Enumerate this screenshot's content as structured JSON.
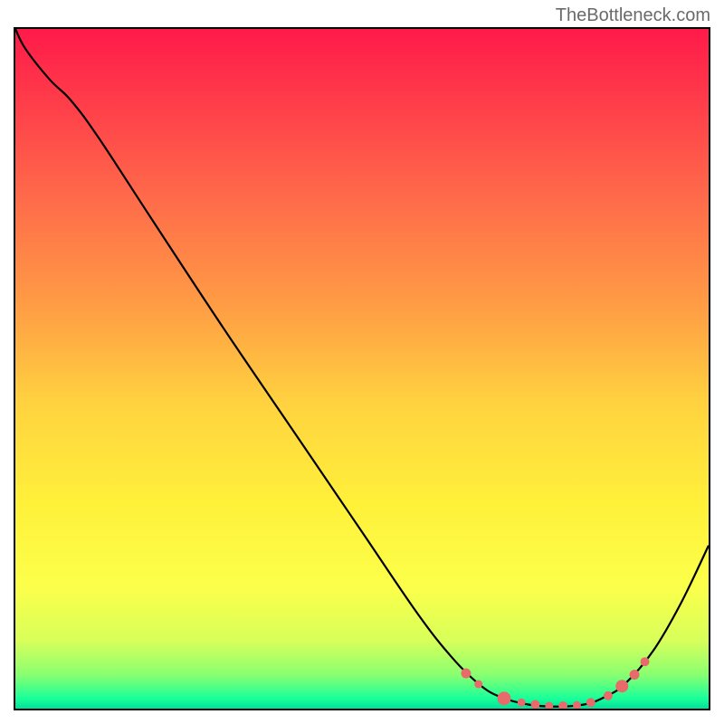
{
  "watermark": "TheBottleneck.com",
  "chart_data": {
    "type": "line",
    "title": "",
    "xlabel": "",
    "ylabel": "",
    "xlim": [
      0,
      100
    ],
    "ylim": [
      0,
      100
    ],
    "background_gradient": {
      "stops": [
        {
          "pos": 0.0,
          "color": "#ff1a4a"
        },
        {
          "pos": 0.1,
          "color": "#ff3a4a"
        },
        {
          "pos": 0.25,
          "color": "#ff6b4a"
        },
        {
          "pos": 0.4,
          "color": "#ff9a45"
        },
        {
          "pos": 0.55,
          "color": "#ffd23f"
        },
        {
          "pos": 0.7,
          "color": "#fff13a"
        },
        {
          "pos": 0.82,
          "color": "#fcff4a"
        },
        {
          "pos": 0.9,
          "color": "#d8ff5a"
        },
        {
          "pos": 0.95,
          "color": "#8aff70"
        },
        {
          "pos": 0.985,
          "color": "#1aff9a"
        },
        {
          "pos": 1.0,
          "color": "#00e09a"
        }
      ]
    },
    "series": [
      {
        "name": "main-curve",
        "stroke": "#000000",
        "stroke_width": 2.2,
        "points": [
          {
            "x": 0.0,
            "y": 100.0
          },
          {
            "x": 1.5,
            "y": 97.0
          },
          {
            "x": 5.0,
            "y": 92.5
          },
          {
            "x": 8.0,
            "y": 89.5
          },
          {
            "x": 12.0,
            "y": 84.0
          },
          {
            "x": 20.0,
            "y": 71.5
          },
          {
            "x": 30.0,
            "y": 56.0
          },
          {
            "x": 40.0,
            "y": 41.0
          },
          {
            "x": 50.0,
            "y": 26.0
          },
          {
            "x": 58.0,
            "y": 14.0
          },
          {
            "x": 63.0,
            "y": 7.5
          },
          {
            "x": 67.0,
            "y": 3.5
          },
          {
            "x": 70.0,
            "y": 1.7
          },
          {
            "x": 74.0,
            "y": 0.6
          },
          {
            "x": 78.0,
            "y": 0.3
          },
          {
            "x": 82.0,
            "y": 0.6
          },
          {
            "x": 85.0,
            "y": 1.7
          },
          {
            "x": 88.0,
            "y": 3.7
          },
          {
            "x": 92.0,
            "y": 8.5
          },
          {
            "x": 96.0,
            "y": 15.5
          },
          {
            "x": 100.0,
            "y": 24.0
          }
        ]
      }
    ],
    "markers": {
      "name": "calibration-dots",
      "color": "#e96a6a",
      "radius_range": [
        4.0,
        7.5
      ],
      "points": [
        {
          "x": 65.0,
          "y": 5.2,
          "r": 5.5
        },
        {
          "x": 66.8,
          "y": 3.6,
          "r": 4.5
        },
        {
          "x": 70.5,
          "y": 1.5,
          "r": 7.5
        },
        {
          "x": 73.0,
          "y": 0.9,
          "r": 4.5
        },
        {
          "x": 75.0,
          "y": 0.6,
          "r": 5.0
        },
        {
          "x": 77.0,
          "y": 0.4,
          "r": 4.5
        },
        {
          "x": 79.0,
          "y": 0.4,
          "r": 5.0
        },
        {
          "x": 81.0,
          "y": 0.5,
          "r": 4.5
        },
        {
          "x": 83.0,
          "y": 0.9,
          "r": 5.0
        },
        {
          "x": 85.5,
          "y": 1.9,
          "r": 5.0
        },
        {
          "x": 87.5,
          "y": 3.3,
          "r": 7.0
        },
        {
          "x": 89.3,
          "y": 5.0,
          "r": 5.5
        },
        {
          "x": 90.8,
          "y": 6.9,
          "r": 5.0
        }
      ]
    }
  }
}
